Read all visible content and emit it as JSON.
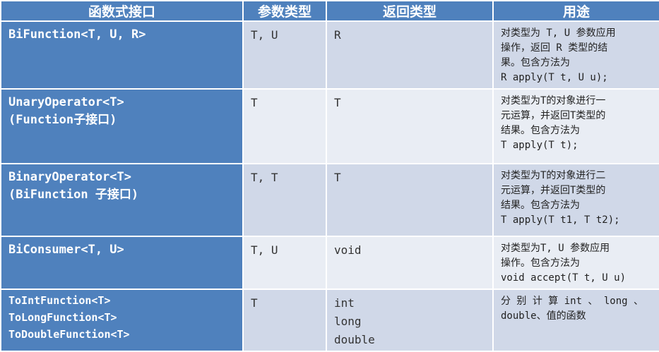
{
  "headers": [
    "函数式接口",
    "参数类型",
    "返回类型",
    "用途"
  ],
  "rows": [
    {
      "interface": [
        "BiFunction<T, U, R>"
      ],
      "params": "T, U",
      "returns": [
        "R"
      ],
      "usage": [
        "对类型为 T, U 参数应用",
        "操作，返回 R 类型的结",
        "果。包含方法为",
        "R apply(T t, U u);"
      ]
    },
    {
      "interface": [
        "UnaryOperator<T>",
        "(Function子接口)"
      ],
      "params": "T",
      "returns": [
        "T"
      ],
      "usage": [
        "对类型为T的对象进行一",
        "元运算，并返回T类型的",
        "结果。包含方法为",
        "T apply(T t);"
      ]
    },
    {
      "interface": [
        "BinaryOperator<T>",
        "(BiFunction 子接口)"
      ],
      "params": "T, T",
      "returns": [
        "T"
      ],
      "usage": [
        "对类型为T的对象进行二",
        "元运算，并返回T类型的",
        "结果。包含方法为",
        "T apply(T t1, T t2);"
      ]
    },
    {
      "interface": [
        "BiConsumer<T, U>"
      ],
      "params": "T, U",
      "returns": [
        "void"
      ],
      "usage": [
        "对类型为T, U 参数应用",
        "操作。包含方法为",
        "void accept(T t, U u)"
      ]
    },
    {
      "interface": [
        "ToIntFunction<T>",
        "ToLongFunction<T>",
        "ToDoubleFunction<T>"
      ],
      "params": "T",
      "returns": [
        "int",
        "long",
        "double"
      ],
      "usage": [
        "分 别 计 算 int 、 long 、",
        "double、值的函数"
      ]
    }
  ]
}
